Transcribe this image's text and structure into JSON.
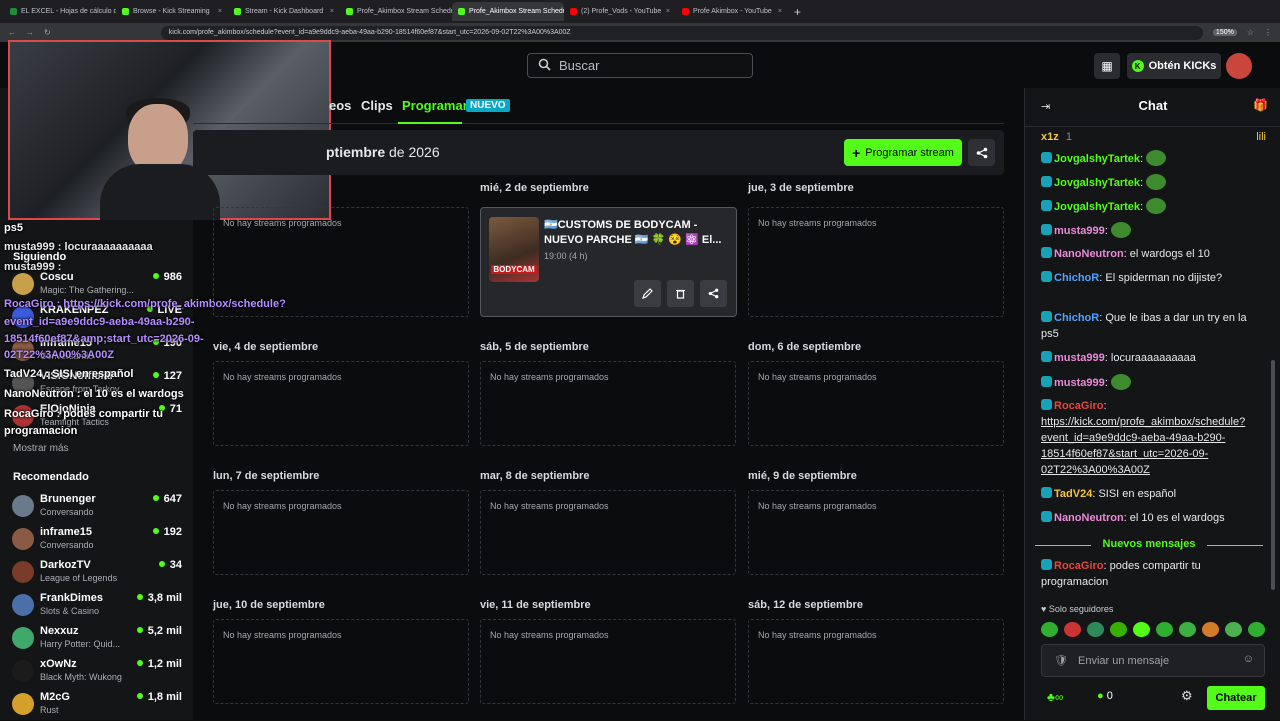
{
  "browser": {
    "tabs": [
      {
        "label": "EL EXCEL - Hojas de cálculo de",
        "color": "#1e8e3e"
      },
      {
        "label": "Browse - Kick Streaming",
        "color": "#53fc18"
      },
      {
        "label": "Stream - Kick Dashboard",
        "color": "#53fc18"
      },
      {
        "label": "Profe_Akimbox Stream Schedul",
        "color": "#53fc18"
      },
      {
        "label": "Profe_Akimbox Stream Schedul",
        "color": "#53fc18"
      },
      {
        "label": "(2) Profe_Vods - YouTube",
        "color": "#ff0000"
      },
      {
        "label": "Profe Akimbox - YouTube",
        "color": "#ff0000"
      }
    ],
    "url": "kick.com/profe_akimbox/schedule?event_id=a9e9ddc9-aeba-49aa-b290-18514f60ef87&start_utc=2026-09-02T22%3A00%3A00Z",
    "zoom": "150%"
  },
  "topnav": {
    "search_placeholder": "Buscar",
    "kicks_label": "Obtén KICKs"
  },
  "overlay": {
    "lines": [
      {
        "text": "ps5",
        "color": "#ffffff"
      },
      {
        "text": "musta999 : locuraaaaaaaaaa",
        "color": "#e6e7e9"
      },
      {
        "text": "musta999 :",
        "color": "#e6e7e9"
      },
      {
        "text": "RocaGiro : https://kick.com/profe_akimbox/schedule?",
        "color": "#b48cff"
      },
      {
        "text": "event_id=a9e9ddc9-aeba-49aa-b290-",
        "color": "#b48cff"
      },
      {
        "text": "18514f60ef87&amp;start_utc=2026-09-",
        "color": "#b48cff"
      },
      {
        "text": "02T22%3A00%3A00Z",
        "color": "#b48cff"
      },
      {
        "text": "TadV24 : SISI en español",
        "color": "#ffffff"
      },
      {
        "text": "NanoNeutron : el 10 es el wardogs",
        "color": "#ffffff"
      },
      {
        "text": "RocaGiro : podes compartir tu",
        "color": "#ffffff"
      },
      {
        "text": "programacion",
        "color": "#ffffff"
      }
    ]
  },
  "sidebar": {
    "following_label": "Siguiendo",
    "following": [
      {
        "name": "Coscu",
        "category": "Magic: The Gathering...",
        "viewers": "986",
        "color": "#c9a04a"
      },
      {
        "name": "KRAKENPEZ",
        "category": "",
        "viewers": "LIVE",
        "color": "#3b5bdb"
      },
      {
        "name": "inframe15",
        "category": "Conversando",
        "viewers": "190",
        "color": "#8a5a44"
      },
      {
        "name": "VISIONofficial",
        "category": "Escape from Tarkov",
        "viewers": "127",
        "color": "#555"
      },
      {
        "name": "ElOjoNinja",
        "category": "Teamfight Tactics",
        "viewers": "71",
        "color": "#a33"
      }
    ],
    "show_more": "Mostrar más",
    "recommended_label": "Recomendado",
    "recommended": [
      {
        "name": "Brunenger",
        "category": "Conversando",
        "viewers": "647",
        "color": "#6a7a8a"
      },
      {
        "name": "inframe15",
        "category": "Conversando",
        "viewers": "192",
        "color": "#8a5a44"
      },
      {
        "name": "DarkozTV",
        "category": "League of Legends",
        "viewers": "34",
        "color": "#7a3b2b"
      },
      {
        "name": "FrankDimes",
        "category": "Slots & Casino",
        "viewers": "3,8 mil",
        "color": "#4b6fa8"
      },
      {
        "name": "Nexxuz",
        "category": "Harry Potter: Quid...",
        "viewers": "5,2 mil",
        "color": "#3fa86a"
      },
      {
        "name": "xOwNz",
        "category": "Black Myth: Wukong",
        "viewers": "1,2 mil",
        "color": "#1b1b1b"
      },
      {
        "name": "M2cG",
        "category": "Rust",
        "viewers": "1,8 mil",
        "color": "#d4a02a"
      }
    ]
  },
  "subnav": {
    "videos": "eos",
    "clips": "Clips",
    "schedule": "Programar",
    "new_badge": "NUEVO"
  },
  "schedule": {
    "month_bold": "ptiembre",
    "month_rest": " de 2026",
    "program_button": "Programar stream",
    "empty_text": "No hay streams programados",
    "days": [
      {
        "label": "mié, 2 de septiembre"
      },
      {
        "label": "jue, 3 de septiembre"
      },
      {
        "label": "vie, 4 de septiembre"
      },
      {
        "label": "sáb, 5 de septiembre"
      },
      {
        "label": "dom, 6 de septiembre"
      },
      {
        "label": "lun, 7 de septiembre"
      },
      {
        "label": "mar, 8 de septiembre"
      },
      {
        "label": "mié, 9 de septiembre"
      },
      {
        "label": "jue, 10 de septiembre"
      },
      {
        "label": "vie, 11 de septiembre"
      },
      {
        "label": "sáb, 12 de septiembre"
      }
    ],
    "event": {
      "title": "🇦🇷CUSTOMS DE BODYCAM - NUEVO PARCHE 🇦🇷 🍀 😵 ⚛️ El...",
      "time": "19:00 (4 h)",
      "thumb_label": "BODYCAM"
    }
  },
  "chat": {
    "title": "Chat",
    "pinned_user": "x1z",
    "pinned_count": "1",
    "pinned_right": "lili",
    "messages": [
      {
        "user": "JovgalshyTartek",
        "text": "",
        "color": "#53fc18"
      },
      {
        "user": "JovgalshyTartek",
        "text": "",
        "color": "#53fc18"
      },
      {
        "user": "JovgalshyTartek",
        "text": "",
        "color": "#53fc18"
      },
      {
        "user": "musta999",
        "text": "",
        "color": "#e88ad8"
      },
      {
        "user": "NanoNeutron",
        "text": "el wardogs el 10",
        "color": "#e88ad8"
      },
      {
        "user": "ChichoR",
        "text": "El spiderman no dijiste?",
        "color": "#4da3ff"
      },
      {
        "user": "ChichoR",
        "text": "Que le ibas a dar un try en la ps5",
        "color": "#4da3ff"
      },
      {
        "user": "musta999",
        "text": "locuraaaaaaaaaa",
        "color": "#e88ad8"
      },
      {
        "user": "musta999",
        "text": "",
        "color": "#e88ad8"
      },
      {
        "user": "RocaGiro",
        "text": "https://kick.com/profe_akimbox/schedule?event_id=a9e9ddc9-aeba-49aa-b290-18514f60ef87&start_utc=2026-09-02T22%3A00%3A00Z",
        "color": "#e6483c"
      },
      {
        "user": "TadV24",
        "text": "SISI en español",
        "color": "#f5c542"
      },
      {
        "user": "NanoNeutron",
        "text": "el 10 es el wardogs",
        "color": "#e88ad8"
      },
      {
        "user": "RocaGiro",
        "text": "podes compartir tu programacion",
        "color": "#e6483c"
      }
    ],
    "new_messages": "Nuevos mensajes",
    "followers_only": "Solo seguidores",
    "input_placeholder": "Enviar un mensaje",
    "points": "0",
    "send_button": "Chatear"
  }
}
